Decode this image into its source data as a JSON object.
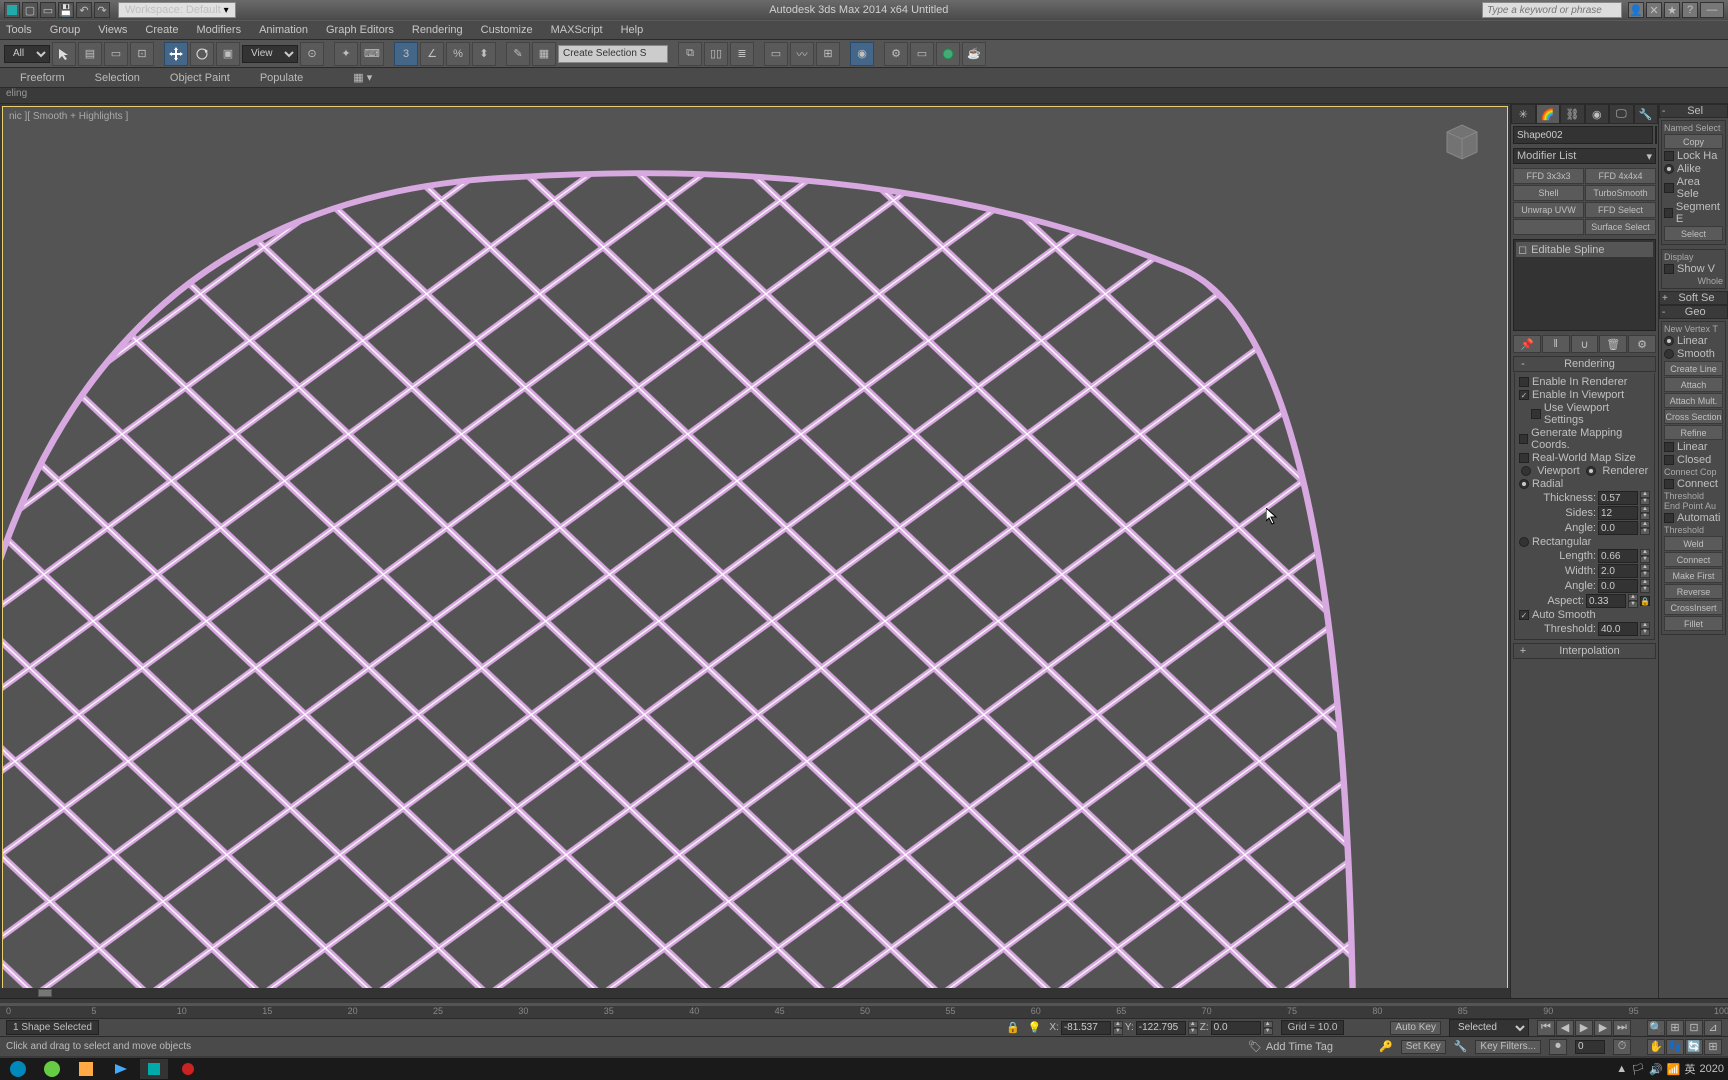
{
  "titlebar": {
    "workspace_label": "Workspace: Default",
    "app_title": "Autodesk 3ds Max  2014 x64      Untitled",
    "search_placeholder": "Type a keyword or phrase"
  },
  "menu": [
    "Tools",
    "Group",
    "Views",
    "Create",
    "Modifiers",
    "Animation",
    "Graph Editors",
    "Rendering",
    "Customize",
    "MAXScript",
    "Help"
  ],
  "main_toolbar": {
    "selection_filter": "All",
    "view_dropdown": "View",
    "named_set_placeholder": "Create Selection S"
  },
  "ribbon_tabs": [
    "Freeform",
    "Selection",
    "Object Paint",
    "Populate"
  ],
  "ribbon_sub_label": "eling",
  "viewport": {
    "shade_label": "nic ][ Smooth + Highlights ]"
  },
  "cmd": {
    "object_name": "Shape002",
    "modifier_list_label": "Modifier List",
    "mod_buttons": [
      "FFD 3x3x3",
      "FFD 4x4x4",
      "Shell",
      "TurboSmooth",
      "Unwrap UVW",
      "FFD Select",
      "",
      "Surface Select"
    ],
    "stack_item": "Editable Spline",
    "rollouts": {
      "rendering_title": "Rendering",
      "enable_renderer": "Enable In Renderer",
      "enable_viewport": "Enable In Viewport",
      "use_vp_settings": "Use Viewport Settings",
      "gen_mapping": "Generate Mapping Coords.",
      "real_world": "Real-World Map Size",
      "viewport_label": "Viewport",
      "renderer_label": "Renderer",
      "radial_label": "Radial",
      "thickness_label": "Thickness:",
      "thickness_value": "0.57",
      "sides_label": "Sides:",
      "sides_value": "12",
      "angle_label": "Angle:",
      "angle_value": "0.0",
      "rectangular_label": "Rectangular",
      "length_label": "Length:",
      "length_value": "0.66",
      "width_label": "Width:",
      "width_value": "2.0",
      "angle2_label": "Angle:",
      "angle2_value": "0.0",
      "aspect_label": "Aspect:",
      "aspect_value": "0.33",
      "auto_smooth": "Auto Smooth",
      "threshold_label": "Threshold:",
      "threshold_value": "40.0",
      "interpolation_title": "Interpolation"
    }
  },
  "extra": {
    "sel_head": "Sel",
    "soft_sel": "Soft Se",
    "geo_head": "Geo",
    "named_sel": "Named Select",
    "copy": "Copy",
    "lock_ha": "Lock Ha",
    "alike": "Alike",
    "area_sel": "Area Sele",
    "segment_e": "Segment E",
    "select_btn": "Select",
    "display": "Display",
    "show_v": "Show V",
    "whole": "Whole",
    "new_vertex": "New Vertex T",
    "linear": "Linear",
    "smooth": "Smooth",
    "create_line": "Create Line",
    "attach": "Attach",
    "attach_mult": "Attach Mult.",
    "cross_section": "Cross Section",
    "refine": "Refine",
    "linear2": "Linear",
    "closed": "Closed",
    "connect_cop": "Connect Cop",
    "connect": "Connect",
    "threshold": "Threshold",
    "end_point": "End Point Au",
    "automatic": "Automati",
    "threshold2": "Threshold",
    "weld": "Weld",
    "connect2": "Connect",
    "make_first": "Make First",
    "reverse": "Reverse",
    "cross_insert": "CrossInsert",
    "fillet": "Fillet"
  },
  "timeline": {
    "ticks": [
      0,
      5,
      10,
      15,
      20,
      25,
      30,
      35,
      40,
      45,
      50,
      55,
      60,
      65,
      70,
      75,
      80,
      85,
      90,
      95,
      100
    ]
  },
  "status": {
    "selection_info": "1 Shape Selected",
    "x_label": "X:",
    "x_val": "-81.537",
    "y_label": "Y:",
    "y_val": "-122.795",
    "z_label": "Z:",
    "z_val": "0.0",
    "grid_label": "Grid = 10.0",
    "autokey": "Auto Key",
    "setkey": "Set Key",
    "selected": "Selected",
    "keyfilters": "Key Filters...",
    "frame": "0",
    "prompt": "Click and drag to select and move objects",
    "add_time_tag": "Add Time Tag"
  },
  "tray": {
    "ime": "英",
    "year": "2020"
  }
}
